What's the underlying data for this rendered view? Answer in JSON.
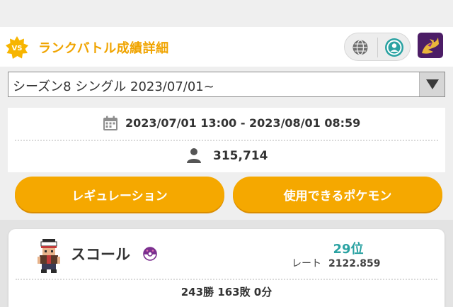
{
  "header": {
    "badge_label": "VS",
    "title": "ランクバトル成績詳細",
    "icons": [
      "globe-icon",
      "user-circle-icon",
      "app-icon"
    ]
  },
  "season": {
    "selected": "シーズン8 シングル 2023/07/01~"
  },
  "info": {
    "period": "2023/07/01 13:00 - 2023/08/01 08:59",
    "player_count": "315,714"
  },
  "buttons": {
    "regulation": "レギュレーション",
    "usable_pokemon": "使用できるポケモン"
  },
  "player": {
    "name": "スコール",
    "rank": "29位",
    "rate_label": "レート",
    "rate_value": "2122.859",
    "record": "243勝 163敗 0分"
  },
  "colors": {
    "accent": "#f5a800",
    "title": "#f0a400",
    "rank": "#2aa2a2",
    "app_icon_bg": "#4c1d66"
  }
}
